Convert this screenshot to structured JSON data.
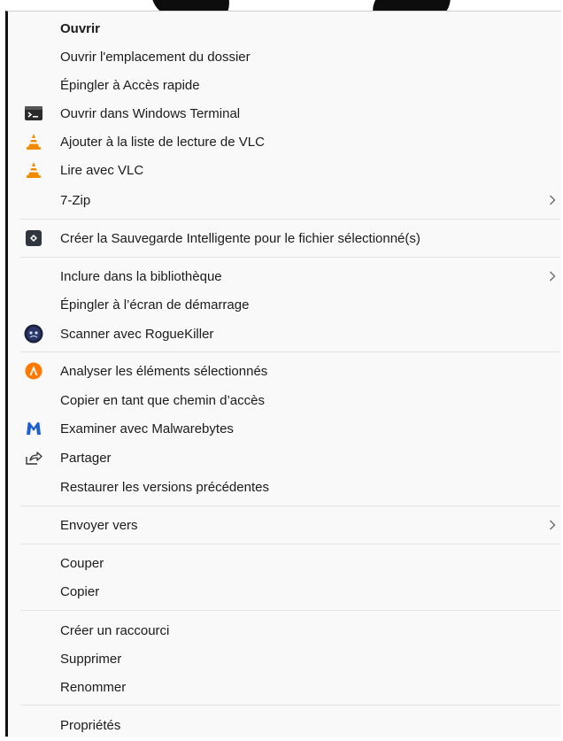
{
  "menu": {
    "items": [
      {
        "label": "Ouvrir"
      },
      {
        "label": "Ouvrir l'emplacement du dossier"
      },
      {
        "label": "Épingler à Accès rapide"
      },
      {
        "label": "Ouvrir dans Windows Terminal",
        "icon": "terminal-icon"
      },
      {
        "label": "Ajouter à la liste de lecture de VLC",
        "icon": "vlc-cone-icon"
      },
      {
        "label": "Lire avec VLC",
        "icon": "vlc-cone-icon"
      },
      {
        "label": "7-Zip",
        "submenu": true
      },
      {
        "label": "Créer la Sauvegarde Intelligente pour le fichier sélectionné(s)",
        "icon": "smart-backup-icon"
      },
      {
        "label": "Inclure dans la bibliothèque",
        "submenu": true
      },
      {
        "label": "Épingler à l’écran de démarrage"
      },
      {
        "label": "Scanner avec RogueKiller",
        "icon": "roguekiller-icon"
      },
      {
        "label": "Analyser les éléments sélectionnés",
        "icon": "avast-icon"
      },
      {
        "label": "Copier en tant que chemin d’accès"
      },
      {
        "label": "Examiner avec Malwarebytes",
        "icon": "malwarebytes-icon"
      },
      {
        "label": "Partager",
        "icon": "share-icon"
      },
      {
        "label": "Restaurer les versions précédentes"
      },
      {
        "label": "Envoyer vers",
        "submenu": true
      },
      {
        "label": "Couper"
      },
      {
        "label": "Copier"
      },
      {
        "label": "Créer un raccourci"
      },
      {
        "label": "Supprimer"
      },
      {
        "label": "Renommer"
      },
      {
        "label": "Propriétés"
      }
    ]
  },
  "colors": {
    "vlc_orange": "#f28b00",
    "avast_orange": "#ff7800",
    "malwarebytes_blue": "#1f5fd1",
    "terminal_dark": "#2b2b2b"
  }
}
